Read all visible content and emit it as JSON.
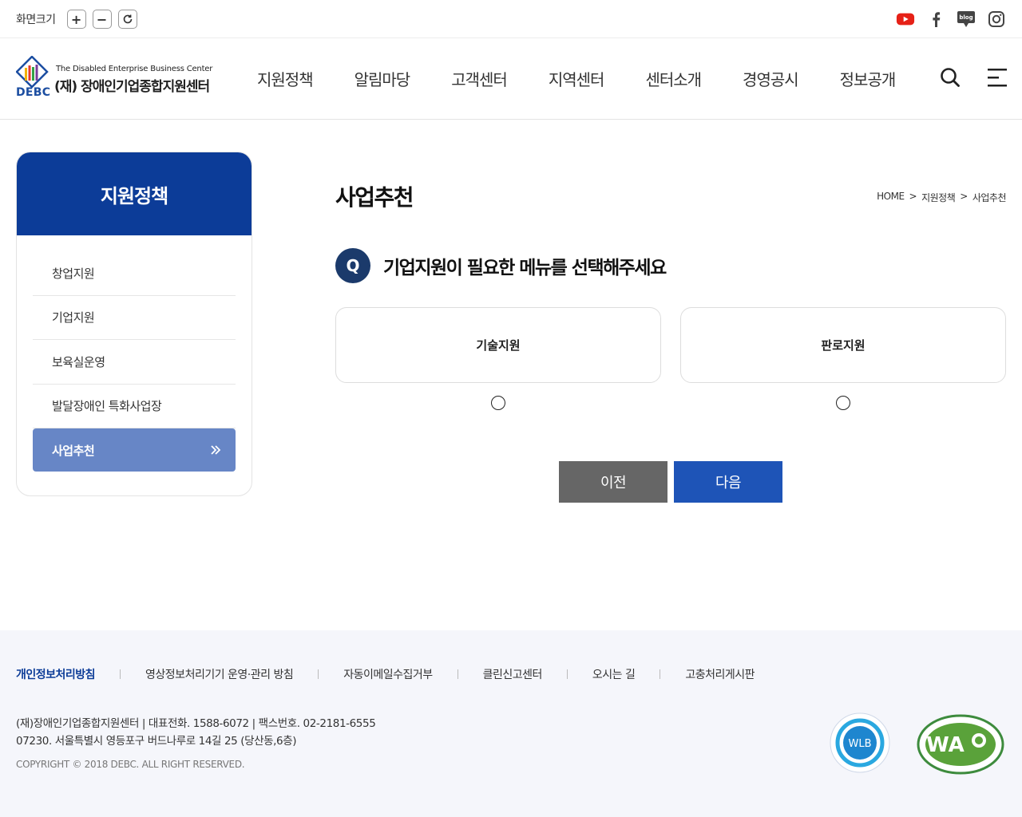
{
  "topbar": {
    "zoom_label": "화면크기",
    "zoom_in": "+",
    "zoom_out": "−",
    "social": [
      "youtube-icon",
      "facebook-icon",
      "blog-icon",
      "instagram-icon"
    ],
    "blog_label": "blog"
  },
  "logo": {
    "english": "The Disabled Enterprise Business Center",
    "korean": "(재) 장애인기업종합지원센터",
    "abbr": "DEBC"
  },
  "gnb": [
    "지원정책",
    "알림마당",
    "고객센터",
    "지역센터",
    "센터소개",
    "경영공시",
    "정보공개"
  ],
  "side": {
    "title": "지원정책",
    "items": [
      "창업지원",
      "기업지원",
      "보육실운영",
      "발달장애인 특화사업장"
    ],
    "active": "사업추천"
  },
  "main": {
    "title": "사업추천",
    "breadcrumb": [
      "HOME",
      ">",
      "지원정책",
      ">",
      "사업추천"
    ],
    "q_badge": "Q",
    "question": "기업지원이 필요한 메뉴를 선택해주세요",
    "options": [
      "기술지원",
      "판로지원"
    ],
    "prev": "이전",
    "next": "다음"
  },
  "footer": {
    "links": [
      "개인정보처리방침",
      "영상정보처리기기 운영·관리 방침",
      "자동이메일수집거부",
      "클린신고센터",
      "오시는 길",
      "고충처리게시판"
    ],
    "info1": "(재)장애인기업종합지원센터  | 대표전화. 1588-6072 | 팩스번호. 02-2181-6555",
    "info2": "07230. 서울특별시 영등포구 버드나루로 14길 25 (당산동,6층)",
    "copyright": "COPYRIGHT © 2018 DEBC. ALL RIGHT RESERVED.",
    "wlb_text": "WLB",
    "wa_text": "WA"
  },
  "colors": {
    "primary": "#0c3c98",
    "active": "#6786c6",
    "next_btn": "#1e54b7",
    "prev_btn": "#666666"
  }
}
